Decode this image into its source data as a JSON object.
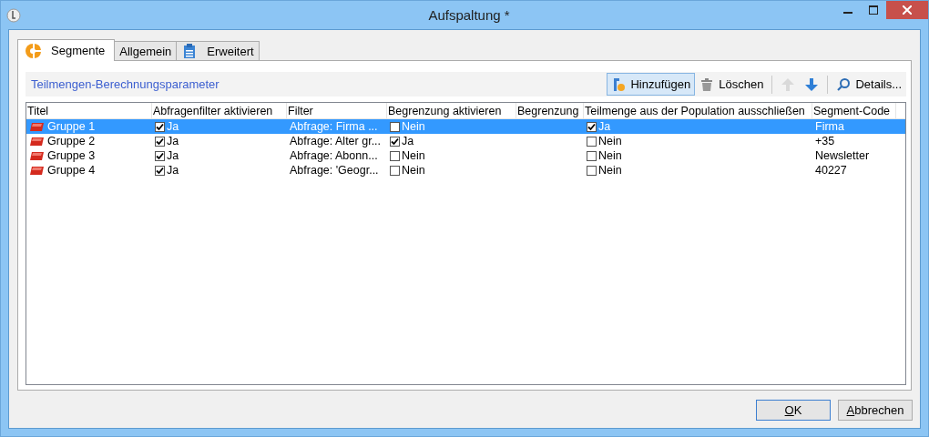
{
  "window": {
    "title": "Aufspaltung *"
  },
  "tabs": [
    {
      "label": "Segmente",
      "selected": true
    },
    {
      "label": "Allgemein",
      "selected": false
    },
    {
      "label": "Erweitert",
      "selected": false
    }
  ],
  "section_title": "Teilmengen-Berechnungsparameter",
  "toolbar": [
    {
      "kind": "button",
      "label": "Hinzufügen",
      "hovered": true,
      "disabled": false
    },
    {
      "kind": "button",
      "label": "Löschen",
      "hovered": false,
      "disabled": false
    },
    {
      "kind": "separator"
    },
    {
      "kind": "icon",
      "hovered": false,
      "disabled": true
    },
    {
      "kind": "icon",
      "hovered": false,
      "disabled": false
    },
    {
      "kind": "separator"
    },
    {
      "kind": "button",
      "label": "Details...",
      "hovered": false,
      "disabled": false
    }
  ],
  "table": {
    "columns": [
      "Titel",
      "Abfragenfilter aktivieren",
      "Filter",
      "Begrenzung aktivieren",
      "Begrenzung",
      "Teilmenge aus der Population ausschließen",
      "Segment-Code"
    ],
    "rows": [
      {
        "selected": true,
        "title": "Gruppe 1",
        "filter_enabled": {
          "checked": true,
          "label": "Ja"
        },
        "filter": "Abfrage: Firma ...",
        "limit_enabled": {
          "checked": false,
          "label": "Nein"
        },
        "exclude": {
          "checked": true,
          "label": "Ja"
        },
        "code": "Firma"
      },
      {
        "selected": false,
        "title": "Gruppe 2",
        "filter_enabled": {
          "checked": true,
          "label": "Ja"
        },
        "filter": "Abfrage: Alter gr...",
        "limit_enabled": {
          "checked": true,
          "label": "Ja"
        },
        "exclude": {
          "checked": false,
          "label": "Nein"
        },
        "code": "+35"
      },
      {
        "selected": false,
        "title": "Gruppe 3",
        "filter_enabled": {
          "checked": true,
          "label": "Ja"
        },
        "filter": "Abfrage: Abonn...",
        "limit_enabled": {
          "checked": false,
          "label": "Nein"
        },
        "exclude": {
          "checked": false,
          "label": "Nein"
        },
        "code": "Newsletter"
      },
      {
        "selected": false,
        "title": "Gruppe 4",
        "filter_enabled": {
          "checked": true,
          "label": "Ja"
        },
        "filter": "Abfrage: 'Geogr...",
        "limit_enabled": {
          "checked": false,
          "label": "Nein"
        },
        "exclude": {
          "checked": false,
          "label": "Nein"
        },
        "code": "40227"
      }
    ]
  },
  "buttons": [
    {
      "label": "OK",
      "default": true
    },
    {
      "label": "Abbrechen",
      "default": false
    }
  ]
}
